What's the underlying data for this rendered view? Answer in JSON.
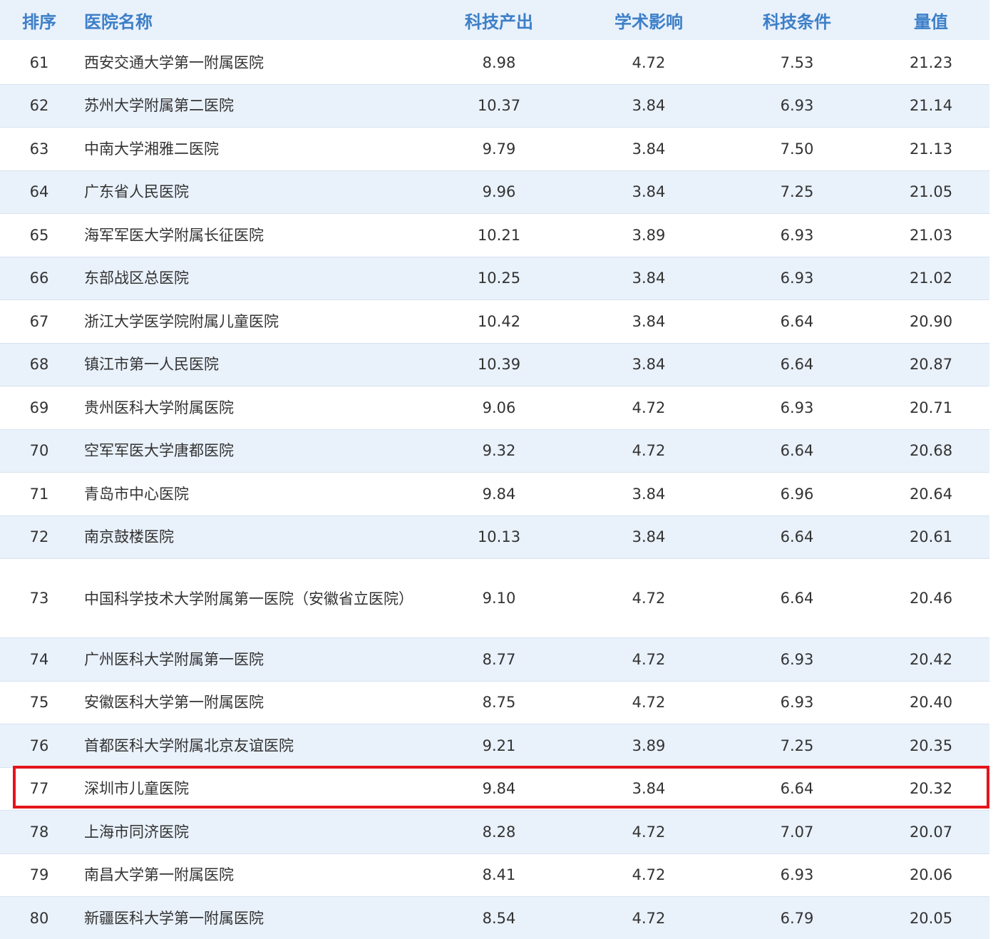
{
  "table": {
    "headers": {
      "rank": "排序",
      "name": "医院名称",
      "output": "科技产出",
      "impact": "学术影响",
      "conditions": "科技条件",
      "value": "量值"
    },
    "highlight_color": "#e3151b",
    "header_color": "#3d7fc8",
    "rows": [
      {
        "rank": "61",
        "name": "西安交通大学第一附属医院",
        "output": "8.98",
        "impact": "4.72",
        "conditions": "7.53",
        "value": "21.23"
      },
      {
        "rank": "62",
        "name": "苏州大学附属第二医院",
        "output": "10.37",
        "impact": "3.84",
        "conditions": "6.93",
        "value": "21.14"
      },
      {
        "rank": "63",
        "name": "中南大学湘雅二医院",
        "output": "9.79",
        "impact": "3.84",
        "conditions": "7.50",
        "value": "21.13"
      },
      {
        "rank": "64",
        "name": "广东省人民医院",
        "output": "9.96",
        "impact": "3.84",
        "conditions": "7.25",
        "value": "21.05"
      },
      {
        "rank": "65",
        "name": "海军军医大学附属长征医院",
        "output": "10.21",
        "impact": "3.89",
        "conditions": "6.93",
        "value": "21.03"
      },
      {
        "rank": "66",
        "name": "东部战区总医院",
        "output": "10.25",
        "impact": "3.84",
        "conditions": "6.93",
        "value": "21.02"
      },
      {
        "rank": "67",
        "name": "浙江大学医学院附属儿童医院",
        "output": "10.42",
        "impact": "3.84",
        "conditions": "6.64",
        "value": "20.90"
      },
      {
        "rank": "68",
        "name": "镇江市第一人民医院",
        "output": "10.39",
        "impact": "3.84",
        "conditions": "6.64",
        "value": "20.87"
      },
      {
        "rank": "69",
        "name": "贵州医科大学附属医院",
        "output": "9.06",
        "impact": "4.72",
        "conditions": "6.93",
        "value": "20.71"
      },
      {
        "rank": "70",
        "name": "空军军医大学唐都医院",
        "output": "9.32",
        "impact": "4.72",
        "conditions": "6.64",
        "value": "20.68"
      },
      {
        "rank": "71",
        "name": "青岛市中心医院",
        "output": "9.84",
        "impact": "3.84",
        "conditions": "6.96",
        "value": "20.64"
      },
      {
        "rank": "72",
        "name": "南京鼓楼医院",
        "output": "10.13",
        "impact": "3.84",
        "conditions": "6.64",
        "value": "20.61"
      },
      {
        "rank": "73",
        "name": "中国科学技术大学附属第一医院（安徽省立医院）",
        "output": "9.10",
        "impact": "4.72",
        "conditions": "6.64",
        "value": "20.46"
      },
      {
        "rank": "74",
        "name": "广州医科大学附属第一医院",
        "output": "8.77",
        "impact": "4.72",
        "conditions": "6.93",
        "value": "20.42"
      },
      {
        "rank": "75",
        "name": "安徽医科大学第一附属医院",
        "output": "8.75",
        "impact": "4.72",
        "conditions": "6.93",
        "value": "20.40"
      },
      {
        "rank": "76",
        "name": "首都医科大学附属北京友谊医院",
        "output": "9.21",
        "impact": "3.89",
        "conditions": "7.25",
        "value": "20.35"
      },
      {
        "rank": "77",
        "name": "深圳市儿童医院",
        "output": "9.84",
        "impact": "3.84",
        "conditions": "6.64",
        "value": "20.32"
      },
      {
        "rank": "78",
        "name": "上海市同济医院",
        "output": "8.28",
        "impact": "4.72",
        "conditions": "7.07",
        "value": "20.07"
      },
      {
        "rank": "79",
        "name": "南昌大学第一附属医院",
        "output": "8.41",
        "impact": "4.72",
        "conditions": "6.93",
        "value": "20.06"
      },
      {
        "rank": "80",
        "name": "新疆医科大学第一附属医院",
        "output": "8.54",
        "impact": "4.72",
        "conditions": "6.79",
        "value": "20.05"
      }
    ]
  }
}
